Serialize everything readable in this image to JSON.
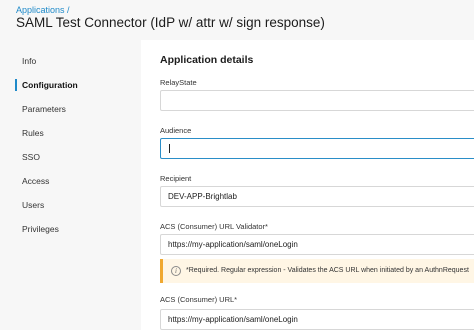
{
  "header": {
    "breadcrumb": "Applications /",
    "title": "SAML Test Connector (IdP w/ attr w/ sign response)"
  },
  "sidebar": {
    "items": [
      {
        "label": "Info"
      },
      {
        "label": "Configuration",
        "active": true
      },
      {
        "label": "Parameters"
      },
      {
        "label": "Rules"
      },
      {
        "label": "SSO"
      },
      {
        "label": "Access"
      },
      {
        "label": "Users"
      },
      {
        "label": "Privileges"
      }
    ]
  },
  "main": {
    "section_title": "Application details",
    "fields": {
      "relay_state": {
        "label": "RelayState",
        "value": ""
      },
      "audience": {
        "label": "Audience",
        "value": ""
      },
      "recipient": {
        "label": "Recipient",
        "value": "DEV-APP-Brightlab"
      },
      "acs_validator": {
        "label": "ACS (Consumer) URL Validator*",
        "value": "https://my-application/saml/oneLogin"
      },
      "acs_url": {
        "label": "ACS (Consumer) URL*",
        "value": "https://my-application/saml/oneLogin"
      }
    },
    "info": {
      "icon": "info-icon",
      "text": "*Required. Regular expression - Validates the ACS URL when initiated by an AuthnRequest"
    }
  },
  "colors": {
    "accent": "#1f8ac9",
    "focus_border": "#2a8ec8",
    "warning_bar": "#f0a830",
    "warning_bg": "#fff6e5"
  }
}
